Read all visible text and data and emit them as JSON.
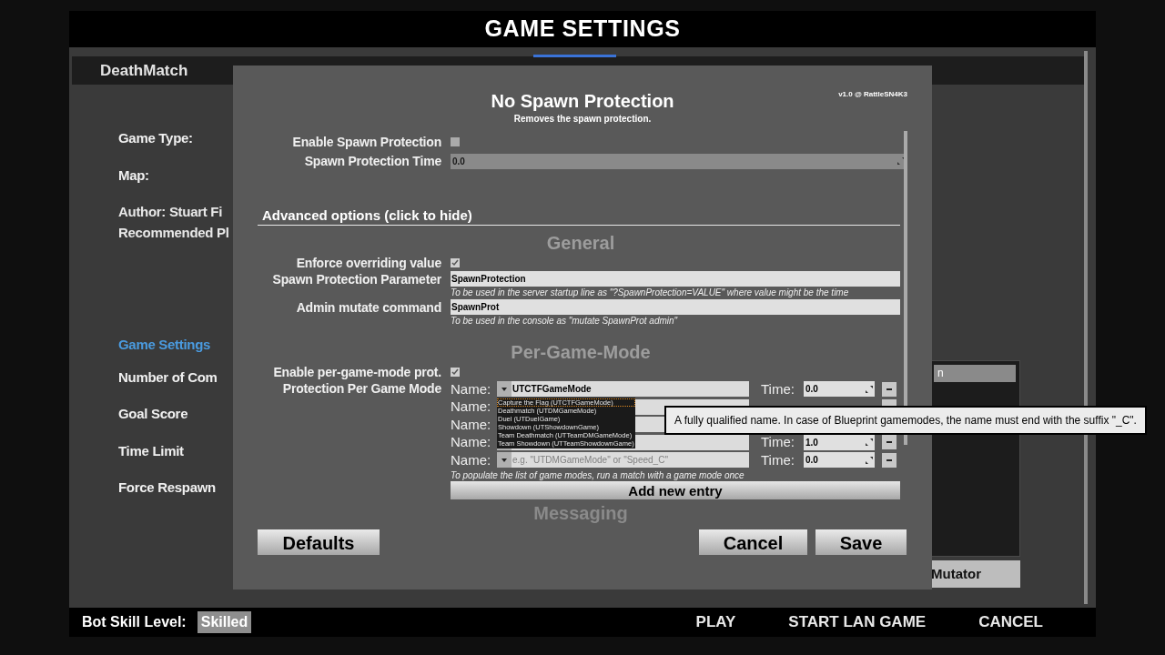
{
  "window": {
    "title": "GAME SETTINGS"
  },
  "tab": {
    "label": "DeathMatch"
  },
  "left_labels": [
    {
      "text": "Game Type:",
      "kind": "label"
    },
    {
      "text": "Map:",
      "kind": "label"
    },
    {
      "text": "Author: Stuart Fi",
      "kind": "info"
    },
    {
      "text": "Recommended Pl",
      "kind": "info"
    },
    {
      "text": "Game Settings",
      "kind": "heading"
    },
    {
      "text": "Number of Com",
      "kind": "label"
    },
    {
      "text": "Goal Score",
      "kind": "label"
    },
    {
      "text": "Time Limit",
      "kind": "label"
    },
    {
      "text": "Force Respawn",
      "kind": "label"
    }
  ],
  "mutator_list": {
    "items": [
      {
        "label": "n",
        "selected": true
      }
    ],
    "button": "Mutator"
  },
  "bottom_bar": {
    "bot_skill_label": "Bot Skill Level:",
    "bot_skill_value": "Skilled",
    "buttons": [
      "PLAY",
      "START LAN GAME",
      "CANCEL"
    ]
  },
  "dialog": {
    "title": "No Spawn Protection",
    "subtitle": "Removes the spawn protection.",
    "version": "v1.0 @ RattleSN4K3",
    "basic": [
      {
        "kind": "checkbox",
        "label": "Enable Spawn Protection",
        "checked": false
      },
      {
        "kind": "number",
        "label": "Spawn Protection Time",
        "value": "0.0",
        "disabled": true
      }
    ],
    "advanced_toggle": "Advanced options (click to hide)",
    "general_heading": "General",
    "general": [
      {
        "kind": "checkbox",
        "label": "Enforce overriding value",
        "checked": true
      },
      {
        "kind": "text",
        "label": "Spawn Protection Parameter",
        "value": "SpawnProtection",
        "hint": "To be used in the server startup line as \"?SpawnProtection=VALUE\" where value might be the time"
      },
      {
        "kind": "text",
        "label": "Admin mutate command",
        "value": "SpawnProt",
        "hint": "To be used in the console as \"mutate SpawnProt admin\""
      }
    ],
    "per_mode_heading": "Per-Game-Mode",
    "per_mode_enable": {
      "label": "Enable per-game-mode prot.",
      "checked": true
    },
    "per_mode_list_label": "Protection Per Game Mode",
    "entries": [
      {
        "name_label": "Name:",
        "value": "UTCTFGameMode",
        "time_label": "Time:",
        "time": "0.0"
      },
      {
        "name_label": "Name:"
      },
      {
        "name_label": "Name:"
      },
      {
        "name_label": "Name:",
        "time_label": "Time:",
        "time": "1.0"
      },
      {
        "name_label": "Name:",
        "placeholder": "e.g. \"UTDMGameMode\" or \"Speed_C\"",
        "time_label": "Time:",
        "time": "0.0"
      }
    ],
    "entries_hint": "To populate the list of game modes, run a match with a game mode once",
    "add_button": "Add new entry",
    "next_heading": "Messaging",
    "buttons": {
      "defaults": "Defaults",
      "cancel": "Cancel",
      "save": "Save"
    },
    "dropdown": [
      {
        "label": "Capture the Flag (UTCTFGameMode)",
        "selected": true
      },
      {
        "label": "Deathmatch (UTDMGameMode)",
        "selected": false
      },
      {
        "label": "Duel (UTDuelGame)",
        "selected": false
      },
      {
        "label": "Showdown (UTShowdownGame)",
        "selected": false
      },
      {
        "label": "Team Deathmatch (UTTeamDMGameMode)",
        "selected": false
      },
      {
        "label": "Team Showdown (UTTeamShowdownGame)",
        "selected": false
      }
    ],
    "tooltip": "A fully qualified name. In case of Blueprint gamemodes, the name must end with the suffix \"_C\"."
  }
}
